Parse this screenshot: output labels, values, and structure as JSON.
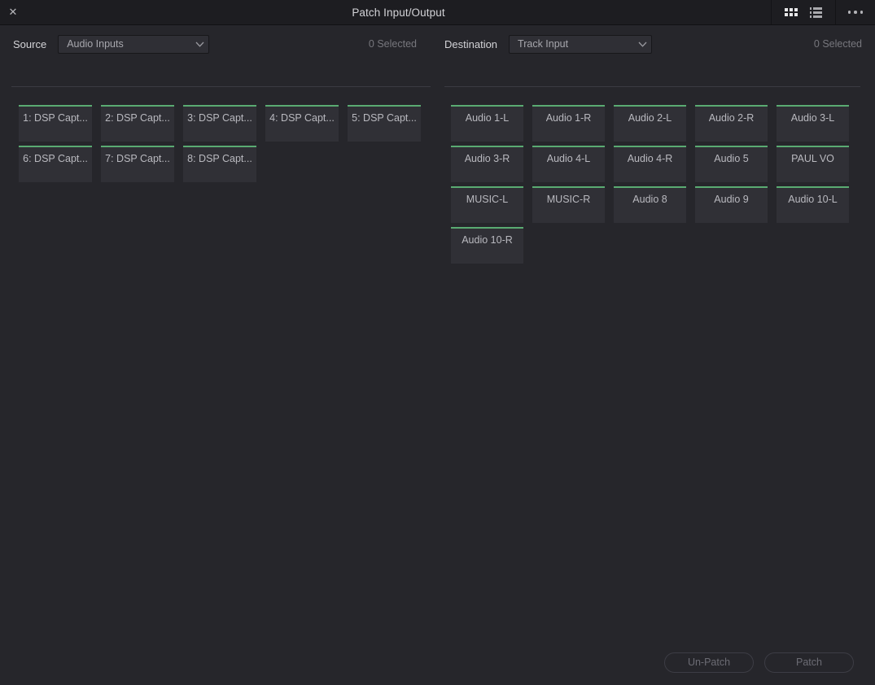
{
  "window": {
    "title": "Patch Input/Output",
    "close_label": "✕",
    "view_grid_icon": "grid-view-icon",
    "view_list_icon": "list-view-icon",
    "more_icon": "more-options-icon"
  },
  "source": {
    "label": "Source",
    "selected_value": "Audio Inputs",
    "selected_count": "0 Selected",
    "options": [
      "Audio Inputs"
    ],
    "cards": [
      {
        "label": "1: DSP Capt..."
      },
      {
        "label": "2: DSP Capt..."
      },
      {
        "label": "3: DSP Capt..."
      },
      {
        "label": "4: DSP Capt..."
      },
      {
        "label": "5: DSP Capt..."
      },
      {
        "label": "6: DSP Capt..."
      },
      {
        "label": "7: DSP Capt..."
      },
      {
        "label": "8: DSP Capt..."
      }
    ]
  },
  "destination": {
    "label": "Destination",
    "selected_value": "Track Input",
    "selected_count": "0 Selected",
    "options": [
      "Track Input"
    ],
    "cards": [
      {
        "label": "Audio 1-L"
      },
      {
        "label": "Audio 1-R"
      },
      {
        "label": "Audio 2-L"
      },
      {
        "label": "Audio 2-R"
      },
      {
        "label": "Audio 3-L"
      },
      {
        "label": "Audio 3-R"
      },
      {
        "label": "Audio 4-L"
      },
      {
        "label": "Audio 4-R"
      },
      {
        "label": "Audio 5"
      },
      {
        "label": "PAUL VO"
      },
      {
        "label": "MUSIC-L"
      },
      {
        "label": "MUSIC-R"
      },
      {
        "label": "Audio 8"
      },
      {
        "label": "Audio 9"
      },
      {
        "label": "Audio 10-L"
      },
      {
        "label": "Audio 10-R"
      }
    ]
  },
  "footer": {
    "unpatch_label": "Un-Patch",
    "patch_label": "Patch"
  },
  "colors": {
    "accent_green": "#5aab72",
    "titlebar_bg": "#1d1d21",
    "body_bg": "#26262b",
    "card_bg": "#303036",
    "text_primary": "#d3d3d7",
    "text_muted": "#77777d"
  }
}
